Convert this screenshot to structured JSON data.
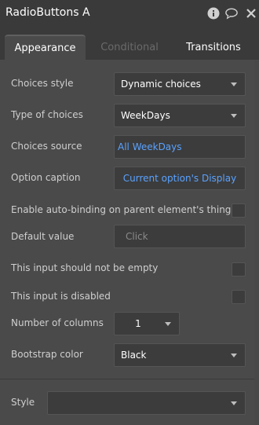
{
  "header": {
    "title": "RadioButtons A",
    "icons": [
      "info-icon",
      "comment-icon",
      "close-icon"
    ]
  },
  "tabs": [
    {
      "label": "Appearance",
      "active": true
    },
    {
      "label": "Conditional",
      "active": false
    },
    {
      "label": "Transitions",
      "active": false
    }
  ],
  "rows": {
    "choices_style": {
      "label": "Choices style",
      "value": "Dynamic choices"
    },
    "type_of_choices": {
      "label": "Type of choices",
      "value": "WeekDays"
    },
    "choices_source": {
      "label": "Choices source",
      "value": "All WeekDays"
    },
    "option_caption": {
      "label": "Option caption",
      "value": "Current option's Display"
    },
    "auto_binding": {
      "label": "Enable auto-binding on parent element's thing",
      "checked": false
    },
    "default_value": {
      "label": "Default value",
      "placeholder": "Click"
    },
    "not_empty": {
      "label": "This input should not be empty",
      "checked": false
    },
    "disabled": {
      "label": "This input is disabled",
      "checked": false
    },
    "num_columns": {
      "label": "Number of columns",
      "value": "1"
    },
    "bootstrap_color": {
      "label": "Bootstrap color",
      "value": "Black"
    },
    "style": {
      "label": "Style",
      "value": ""
    }
  },
  "colors": {
    "panel": "#4a4a4a",
    "header": "#3a3a3a",
    "link": "#5aa2ff"
  }
}
